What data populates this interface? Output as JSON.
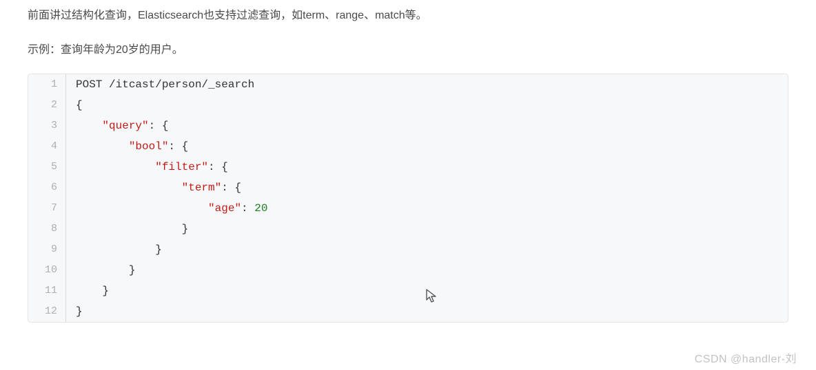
{
  "intro": "前面讲过结构化查询，Elasticsearch也支持过滤查询，如term、range、match等。",
  "example_label": "示例：查询年龄为20岁的用户。",
  "watermark": "CSDN @handler-刘",
  "code": {
    "lines": [
      {
        "n": "1",
        "tokens": [
          {
            "cls": "pln",
            "text": "POST /itcast/person/_search"
          }
        ]
      },
      {
        "n": "2",
        "tokens": [
          {
            "cls": "pln",
            "text": "{"
          }
        ]
      },
      {
        "n": "3",
        "tokens": [
          {
            "cls": "pln",
            "text": "    "
          },
          {
            "cls": "str",
            "text": "\"query\""
          },
          {
            "cls": "pln",
            "text": ": {"
          }
        ]
      },
      {
        "n": "4",
        "tokens": [
          {
            "cls": "pln",
            "text": "        "
          },
          {
            "cls": "str",
            "text": "\"bool\""
          },
          {
            "cls": "pln",
            "text": ": {"
          }
        ]
      },
      {
        "n": "5",
        "tokens": [
          {
            "cls": "pln",
            "text": "            "
          },
          {
            "cls": "str",
            "text": "\"filter\""
          },
          {
            "cls": "pln",
            "text": ": {"
          }
        ]
      },
      {
        "n": "6",
        "tokens": [
          {
            "cls": "pln",
            "text": "                "
          },
          {
            "cls": "str",
            "text": "\"term\""
          },
          {
            "cls": "pln",
            "text": ": {"
          }
        ]
      },
      {
        "n": "7",
        "tokens": [
          {
            "cls": "pln",
            "text": "                    "
          },
          {
            "cls": "str",
            "text": "\"age\""
          },
          {
            "cls": "pln",
            "text": ": "
          },
          {
            "cls": "num",
            "text": "20"
          }
        ]
      },
      {
        "n": "8",
        "tokens": [
          {
            "cls": "pln",
            "text": "                }"
          }
        ]
      },
      {
        "n": "9",
        "tokens": [
          {
            "cls": "pln",
            "text": "            }"
          }
        ]
      },
      {
        "n": "10",
        "tokens": [
          {
            "cls": "pln",
            "text": "        }"
          }
        ]
      },
      {
        "n": "11",
        "tokens": [
          {
            "cls": "pln",
            "text": "    }"
          }
        ]
      },
      {
        "n": "12",
        "tokens": [
          {
            "cls": "pln",
            "text": "}"
          }
        ]
      }
    ]
  }
}
